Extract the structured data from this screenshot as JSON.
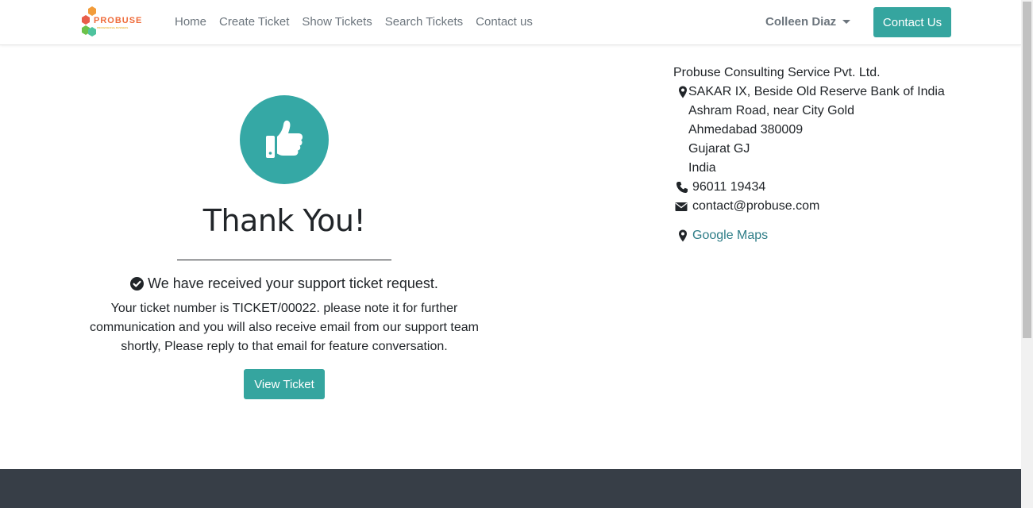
{
  "nav": {
    "logo_text": "PROBUSE",
    "logo_subtext": "PROFESSIONAL BUSINESS",
    "links": [
      "Home",
      "Create Ticket",
      "Show Tickets",
      "Search Tickets",
      "Contact us"
    ],
    "user_name": "Colleen Diaz",
    "contact_button": "Contact Us"
  },
  "main": {
    "heading": "Thank You!",
    "received": "We have received your support ticket request.",
    "note": "Your ticket number is TICKET/00022. please note it for further communication and you will also receive email from our support team shortly, Please reply to that email for feature conversation.",
    "view_button": "View Ticket"
  },
  "address": {
    "company": "Probuse Consulting Service Pvt. Ltd.",
    "street1": "SAKAR IX, Beside Old Reserve Bank of India",
    "street2": "Ashram Road, near City Gold",
    "city": "Ahmedabad 380009",
    "state": "Gujarat GJ",
    "country": "India",
    "phone": "96011 19434",
    "email": "contact@probuse.com",
    "maps": "Google Maps"
  },
  "colors": {
    "accent": "#35a59f",
    "footer": "#373e47",
    "link": "#2e7d87"
  },
  "icons": [
    "thumbs-up-icon",
    "check-circle-icon",
    "map-marker-icon",
    "phone-icon",
    "envelope-icon"
  ]
}
